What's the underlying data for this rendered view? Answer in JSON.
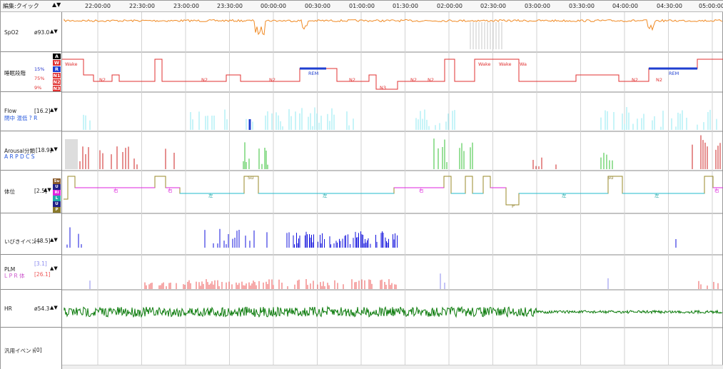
{
  "header": {
    "edit_label": "編集:クイック",
    "arrows": "▲▼"
  },
  "time_labels": [
    "22:00:00",
    "22:30:00",
    "23:00:00",
    "23:30:00",
    "00:00:00",
    "00:30:00",
    "01:00:00",
    "01:30:00",
    "02:00:00",
    "02:30:00",
    "03:00:00",
    "03:30:00",
    "04:00:00",
    "04:30:00",
    "05:00:00"
  ],
  "rows": {
    "spo2": {
      "name": "SpO2",
      "value": "ø93.0",
      "arrows": "▲▼",
      "scale_top": "100",
      "scale_bottom": "70"
    },
    "sleep": {
      "name": "睡眠段階",
      "arrows": "",
      "stages": [
        {
          "code": "A",
          "color": "#000000"
        },
        {
          "code": "W",
          "color": "#e03030"
        },
        {
          "code": "R",
          "color": "#1f3fd0"
        },
        {
          "code": "N1",
          "color": "#e03030"
        },
        {
          "code": "N2",
          "color": "#e03030"
        },
        {
          "code": "N3",
          "color": "#e03030"
        }
      ],
      "percentages": [
        {
          "text": "15%",
          "color": "#2233cc"
        },
        {
          "text": "75%",
          "color": "#e03030"
        },
        {
          "text": "9%",
          "color": "#e03030"
        }
      ],
      "plot_labels": [
        {
          "text": "Wake",
          "color": "#e03030"
        },
        {
          "text": "N2",
          "color": "#e03030"
        },
        {
          "text": "N2",
          "color": "#e03030"
        },
        {
          "text": "N2",
          "color": "#e03030"
        },
        {
          "text": "REM",
          "color": "#1f3fd0"
        },
        {
          "text": "N2",
          "color": "#e03030"
        },
        {
          "text": "N3",
          "color": "#e03030"
        },
        {
          "text": "N2",
          "color": "#e03030"
        },
        {
          "text": "N2",
          "color": "#e03030"
        },
        {
          "text": "Wake",
          "color": "#e03030"
        },
        {
          "text": "Wake",
          "color": "#e03030"
        },
        {
          "text": "Wa",
          "color": "#e03030"
        },
        {
          "text": "N2",
          "color": "#e03030"
        },
        {
          "text": "N2",
          "color": "#e03030"
        },
        {
          "text": "REM",
          "color": "#1f3fd0"
        }
      ]
    },
    "flow": {
      "name": "Flow",
      "value": "[16.2]",
      "arrows": "▲▼",
      "scale_top": "120",
      "scale_bottom": "0",
      "legend": "閉中 混低 ? R"
    },
    "arousal": {
      "name": "Arousal分類",
      "value": "[18.9]",
      "arrows": "▲▼",
      "scale_top": "29",
      "scale_bottom": "0",
      "legend": "A R P D C S"
    },
    "position": {
      "name": "体位",
      "value": "[2.5]",
      "arrows": "▲▼",
      "boxes": [
        {
          "code": "Su",
          "color": "#8a5a2a"
        },
        {
          "code": "U",
          "color": "#222288"
        },
        {
          "code": "Ri",
          "color": "#dd22dd"
        },
        {
          "code": "L",
          "color": "#22aaaa"
        },
        {
          "code": "U",
          "color": "#222288"
        },
        {
          "code": "P",
          "color": "#8a7a2a"
        }
      ],
      "plot_labels": [
        {
          "text": "右",
          "color": "#dd22dd"
        },
        {
          "text": "右",
          "color": "#dd22dd"
        },
        {
          "text": "左",
          "color": "#22aaaa"
        },
        {
          "text": "Su",
          "color": "#8a7a2a"
        },
        {
          "text": "左",
          "color": "#22aaaa"
        },
        {
          "text": "右",
          "color": "#dd22dd"
        },
        {
          "text": "P",
          "color": "#8a7a2a"
        },
        {
          "text": "左",
          "color": "#22aaaa"
        },
        {
          "text": "Su",
          "color": "#8a7a2a"
        },
        {
          "text": "左",
          "color": "#22aaaa"
        },
        {
          "text": "右",
          "color": "#dd22dd"
        }
      ]
    },
    "snore": {
      "name": "いびきイベント",
      "value": "[48.5]",
      "arrows": "▲▼"
    },
    "plm": {
      "name": "PLM",
      "value1": "[3.1]",
      "value2": "[26.1]",
      "arrows": "▲▼",
      "legend": "L P R 体",
      "scale_top": "203",
      "scale_bottom": "0"
    },
    "hr": {
      "name": "HR",
      "value": "ø54.3",
      "arrows": "▲▼",
      "scale_top": "112",
      "scale_bottom": "27"
    },
    "general": {
      "name": "汎用イベント",
      "value": "[0]"
    }
  },
  "colors": {
    "spo2": "#f08a24",
    "sleep": "#e03030",
    "rem": "#1f3fd0",
    "flow": "#8fe8f2",
    "arousal_green": "#34c234",
    "arousal_red": "#cc2222",
    "position_magenta": "#dd22dd",
    "position_cyan": "#22bbcc",
    "position_olive": "#9a8a2a",
    "snore": "#1010dd",
    "plm_red": "#ee5555",
    "plm_blue": "#8888ee",
    "hr": "#0a7a0a",
    "grid": "#d2d2d2"
  }
}
